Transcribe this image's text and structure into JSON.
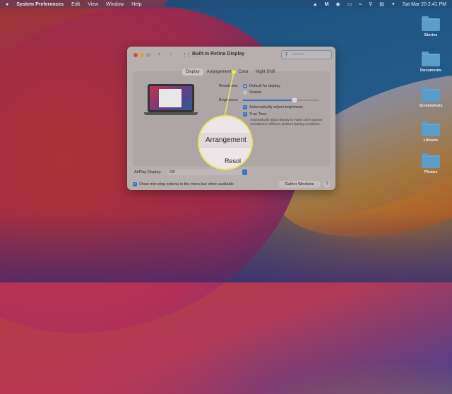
{
  "menubar": {
    "app": "System Preferences",
    "items": [
      "Edit",
      "View",
      "Window",
      "Help"
    ],
    "clock": "Sat Mar 20  2:41 PM",
    "status_icons": [
      "vlc-icon",
      "malwarebytes-icon",
      "record-icon",
      "battery-icon",
      "wifi-icon",
      "search-icon",
      "control-center-icon",
      "siri-icon"
    ]
  },
  "desktop": {
    "folders": [
      "Stories",
      "Documents",
      "Screenshots",
      "Lifewire",
      "Photos"
    ]
  },
  "window": {
    "title": "Built-in Retina Display",
    "search_placeholder": "Search",
    "tabs": [
      "Display",
      "Arrangement",
      "Color",
      "Night Shift"
    ],
    "selected_tab": "Display",
    "resolution_label": "Resolution:",
    "resolution_options": [
      "Default for display",
      "Scaled"
    ],
    "resolution_selected": "Default for display",
    "brightness_label": "Brightness:",
    "brightness_value": 0.68,
    "auto_brightness": {
      "label": "Automatically adjust brightness",
      "checked": true
    },
    "true_tone": {
      "label": "True Tone",
      "checked": true,
      "description": "Automatically adapt display to make colors appear consistent in different ambient lighting conditions."
    },
    "airplay_label": "AirPlay Display:",
    "airplay_value": "Off",
    "mirroring": {
      "label": "Show mirroring options in the menu bar when available",
      "checked": true
    },
    "gather_windows": "Gather Windows",
    "help": "?"
  },
  "callout": {
    "text": "Arrangement",
    "partial": "Resol",
    "color": "#e9e35a"
  }
}
